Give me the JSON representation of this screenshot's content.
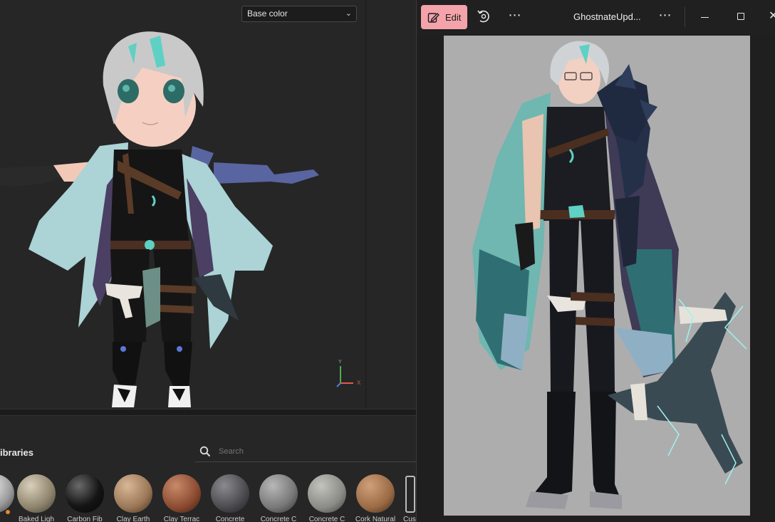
{
  "editor": {
    "channel_select": {
      "value": "Base color"
    },
    "axis_labels": {
      "y": "Y",
      "x": "X"
    },
    "libraries_title": "ibraries",
    "search": {
      "placeholder": "Search"
    },
    "materials": [
      {
        "label": "...",
        "color": "#d0d0d0"
      },
      {
        "label": "Baked Ligh",
        "color": "#9a8f7a"
      },
      {
        "label": "Carbon Fib",
        "color": "#1a1a1a"
      },
      {
        "label": "Clay Earth",
        "color": "#a88361"
      },
      {
        "label": "Clay Terrac",
        "color": "#8a4a30"
      },
      {
        "label": "Concrete",
        "color": "#4a4a4e"
      },
      {
        "label": "Concrete C",
        "color": "#777777"
      },
      {
        "label": "Concrete C",
        "color": "#8a8a86"
      },
      {
        "label": "Cork Natural",
        "color": "#9a6a44"
      },
      {
        "label": "Cus",
        "color": "#3a3a3a"
      }
    ]
  },
  "photos": {
    "edit_label": "Edit",
    "file_title": "GhostnateUpd...",
    "accent": "#f4a3aa"
  }
}
